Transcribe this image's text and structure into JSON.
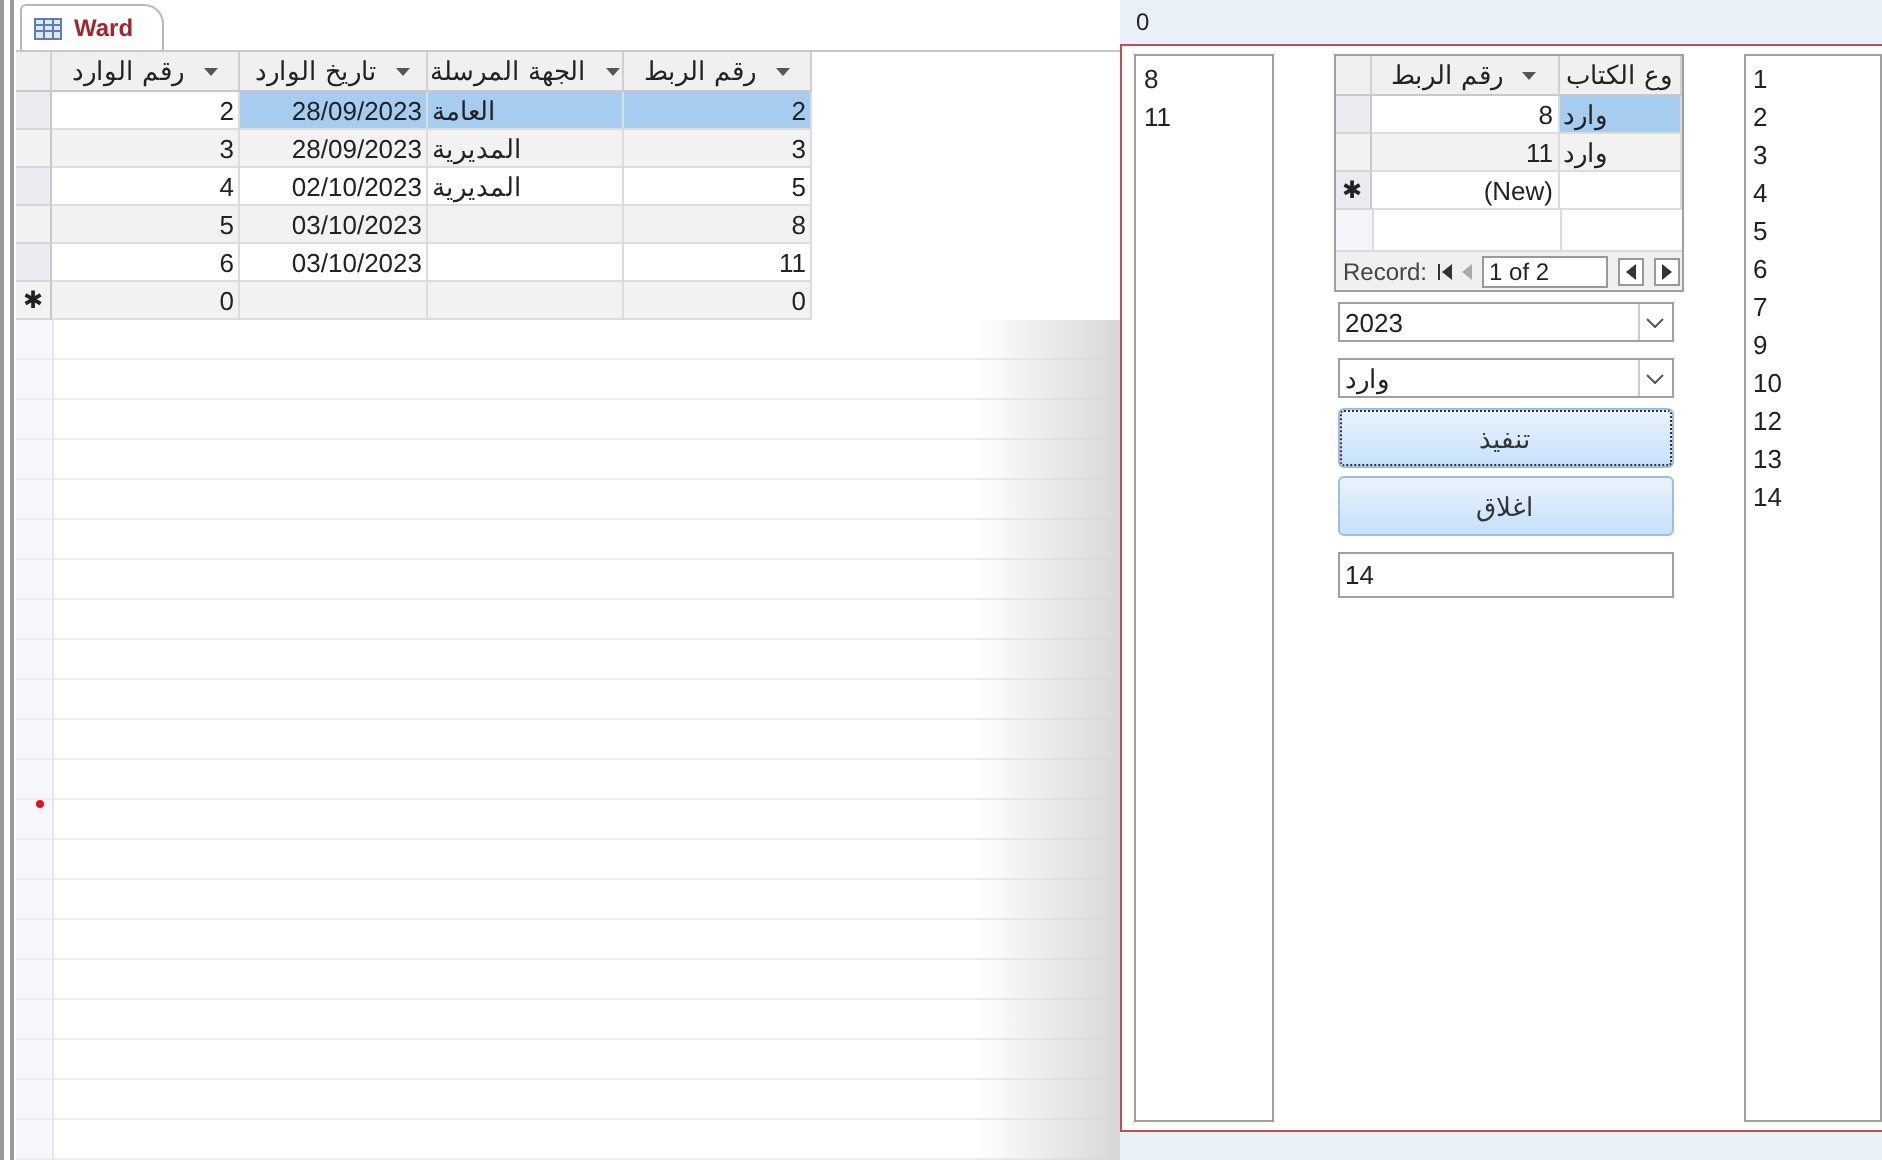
{
  "datasheet": {
    "tab": {
      "label": "Ward",
      "selected": true
    },
    "columns": [
      "رقم الربط",
      "الجهة المرسلة",
      "تاريخ الوارد",
      "رقم الوارد"
    ],
    "rows": [
      {
        "cells": [
          "2",
          "العامة",
          "28/09/2023",
          "2"
        ],
        "selected": true
      },
      {
        "cells": [
          "3",
          "المديرية",
          "28/09/2023",
          "3"
        ],
        "selected": false
      },
      {
        "cells": [
          "5",
          "المديرية",
          "02/10/2023",
          "4"
        ],
        "selected": false
      },
      {
        "cells": [
          "8",
          null,
          "03/10/2023",
          "5"
        ],
        "selected": false
      },
      {
        "cells": [
          "11",
          null,
          "03/10/2023",
          "6"
        ],
        "selected": false
      },
      {
        "selector": "✱",
        "cells": [
          "0",
          null,
          null,
          "0"
        ],
        "selected": false
      }
    ]
  },
  "form": {
    "header_value": "0",
    "left_list": [
      "8",
      "11"
    ],
    "subform": {
      "columns": [
        "وع الكتاب",
        "رقم الربط"
      ],
      "rows": [
        {
          "cells": [
            "وارد",
            "8"
          ],
          "selected": true
        },
        {
          "cells": [
            "وارد",
            "11"
          ],
          "selected": false
        },
        {
          "selector": "✱",
          "cells": [
            null,
            "(New)"
          ],
          "selected": false
        }
      ],
      "navigator": {
        "label": "Record:",
        "position": "1 of 2"
      }
    },
    "year_combo": {
      "value": "2023"
    },
    "type_combo": {
      "value": "وارد"
    },
    "buttons": [
      {
        "label": "تنفيذ",
        "focused": true
      },
      {
        "label": "اغلاق",
        "focused": false
      }
    ],
    "count_field": {
      "value": "14"
    },
    "right_list": [
      "1",
      "2",
      "3",
      "4",
      "5",
      "6",
      "7",
      "9",
      "10",
      "12",
      "13",
      "14"
    ]
  }
}
